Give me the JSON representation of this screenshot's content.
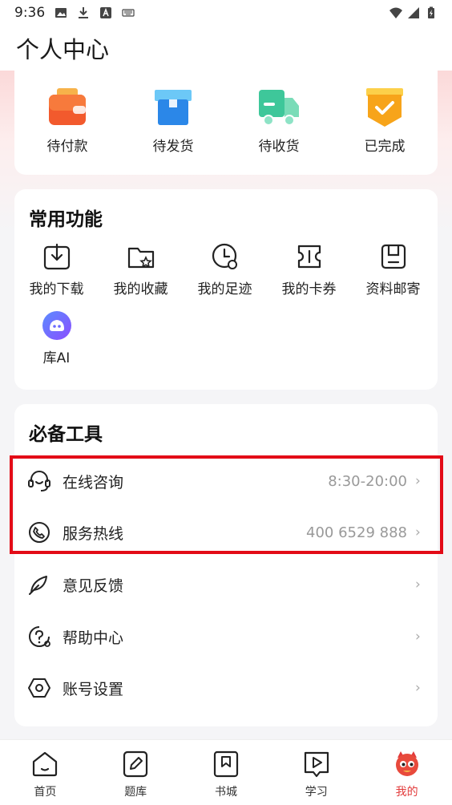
{
  "status_bar": {
    "time": "9:36"
  },
  "header": {
    "title": "个人中心"
  },
  "orders": {
    "items": [
      {
        "label": "待付款",
        "icon": "wallet-icon"
      },
      {
        "label": "待发货",
        "icon": "box-icon"
      },
      {
        "label": "待收货",
        "icon": "truck-icon"
      },
      {
        "label": "已完成",
        "icon": "completed-icon"
      }
    ]
  },
  "common": {
    "title": "常用功能",
    "items": [
      {
        "label": "我的下载",
        "icon": "download-icon"
      },
      {
        "label": "我的收藏",
        "icon": "favorite-folder-icon"
      },
      {
        "label": "我的足迹",
        "icon": "history-icon"
      },
      {
        "label": "我的卡券",
        "icon": "coupon-icon"
      },
      {
        "label": "资料邮寄",
        "icon": "mail-package-icon"
      },
      {
        "label": "库AI",
        "icon": "ai-bot-icon"
      }
    ]
  },
  "tools": {
    "title": "必备工具",
    "rows": [
      {
        "label": "在线咨询",
        "value": "8:30-20:00",
        "icon": "headset-icon"
      },
      {
        "label": "服务热线",
        "value": "400 6529 888",
        "icon": "phone-icon"
      },
      {
        "label": "意见反馈",
        "value": "",
        "icon": "feather-icon"
      },
      {
        "label": "帮助中心",
        "value": "",
        "icon": "help-icon"
      },
      {
        "label": "账号设置",
        "value": "",
        "icon": "settings-icon"
      }
    ]
  },
  "tabbar": {
    "tabs": [
      {
        "label": "首页",
        "icon": "home-icon"
      },
      {
        "label": "题库",
        "icon": "edit-icon"
      },
      {
        "label": "书城",
        "icon": "bookmark-icon"
      },
      {
        "label": "学习",
        "icon": "play-book-icon"
      },
      {
        "label": "我的",
        "icon": "mascot-icon",
        "active": true
      }
    ]
  },
  "colors": {
    "accent": "#e23b3b",
    "highlight_border": "#e30b17"
  }
}
